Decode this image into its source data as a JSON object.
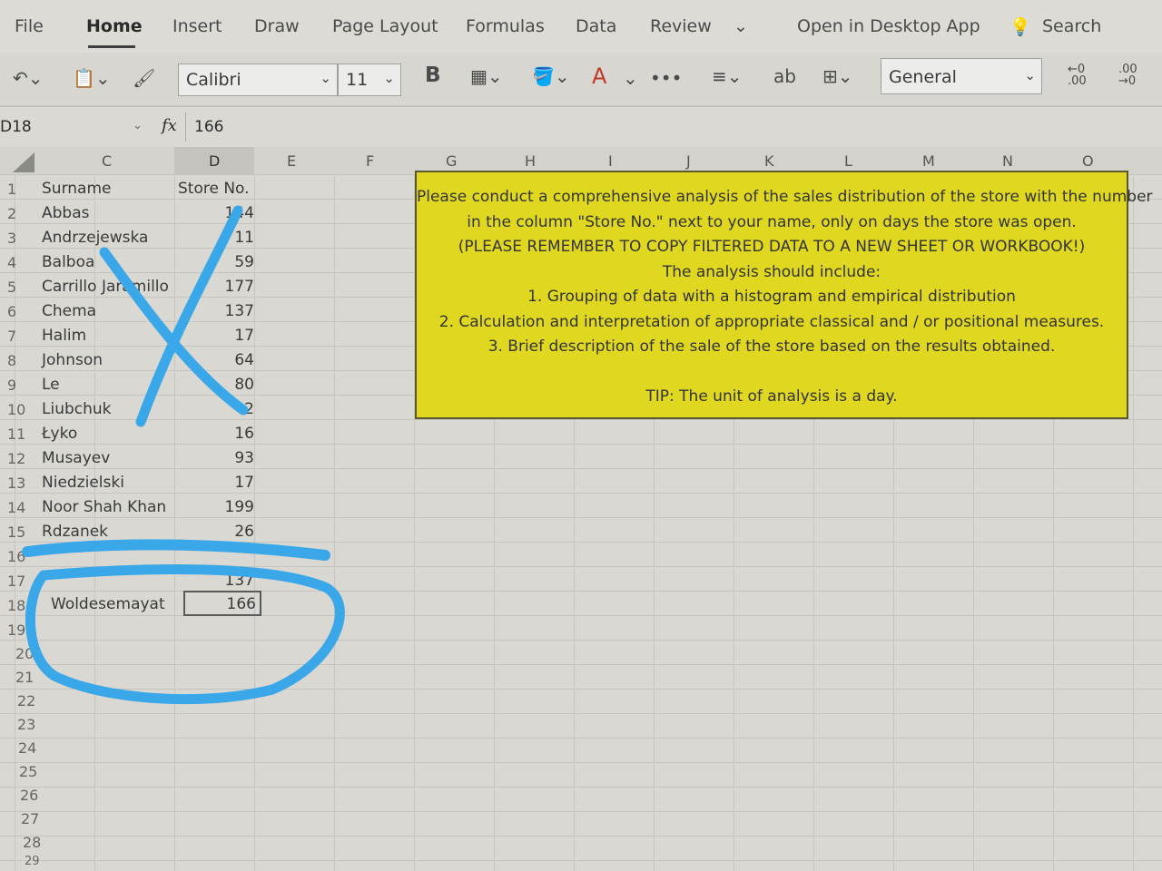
{
  "ribbon": {
    "tabs": [
      "File",
      "Home",
      "Insert",
      "Draw",
      "Page Layout",
      "Formulas",
      "Data",
      "Review"
    ],
    "open_desktop": "Open in Desktop App",
    "search": "Search"
  },
  "toolbar": {
    "font_name": "Calibri",
    "font_size": "11",
    "bold": "B",
    "number_format": "General",
    "more": "•••"
  },
  "formula_bar": {
    "cell_ref": "D18",
    "fx": "fx",
    "value": "166"
  },
  "columns": [
    "C",
    "D",
    "E",
    "F",
    "G",
    "H",
    "I",
    "J",
    "K",
    "L",
    "M",
    "N",
    "O"
  ],
  "rows": [
    {
      "n": "1",
      "surname": "Surname",
      "store": "Store No."
    },
    {
      "n": "2",
      "surname": "Abbas",
      "store": "144"
    },
    {
      "n": "3",
      "surname": "Andrzejewska",
      "store": "11"
    },
    {
      "n": "4",
      "surname": "Balboa",
      "store": "59"
    },
    {
      "n": "5",
      "surname": "Carrillo Jaramillo",
      "store": "177"
    },
    {
      "n": "6",
      "surname": "Chema",
      "store": "137"
    },
    {
      "n": "7",
      "surname": "Halim",
      "store": "17"
    },
    {
      "n": "8",
      "surname": "Johnson",
      "store": "64"
    },
    {
      "n": "9",
      "surname": "Le",
      "store": "80"
    },
    {
      "n": "10",
      "surname": "Liubchuk",
      "store": "2"
    },
    {
      "n": "11",
      "surname": "Łyko",
      "store": "16"
    },
    {
      "n": "12",
      "surname": "Musayev",
      "store": "93"
    },
    {
      "n": "13",
      "surname": "Niedzielski",
      "store": "17"
    },
    {
      "n": "14",
      "surname": "Noor Shah Khan",
      "store": "199"
    },
    {
      "n": "15",
      "surname": "Rdzanek",
      "store": "26"
    },
    {
      "n": "16",
      "surname": "",
      "store": ""
    },
    {
      "n": "17",
      "surname": "",
      "store": "137"
    },
    {
      "n": "18",
      "surname": "Woldesemayat",
      "store": "166"
    }
  ],
  "empty_rows": [
    "19",
    "20",
    "21",
    "22",
    "23",
    "24",
    "25",
    "26",
    "27",
    "28",
    "29"
  ],
  "instructions": {
    "line1": "Please conduct a comprehensive analysis of the sales distribution of the store with the number",
    "line2": "in the column \"Store No.\" next to your name, only on days the store was open.",
    "line3": "(PLEASE REMEMBER TO COPY FILTERED DATA TO A NEW SHEET OR WORKBOOK!)",
    "line4": "The analysis should include:",
    "line5": "1. Grouping of data with a histogram and empirical distribution",
    "line6": "2. Calculation and interpretation of appropriate classical and / or positional measures.",
    "line7": "3. Brief description of the sale of the store based on the results obtained.",
    "tip": "TIP: The unit of analysis is a day."
  },
  "annotation_color": "#3aa8e8"
}
